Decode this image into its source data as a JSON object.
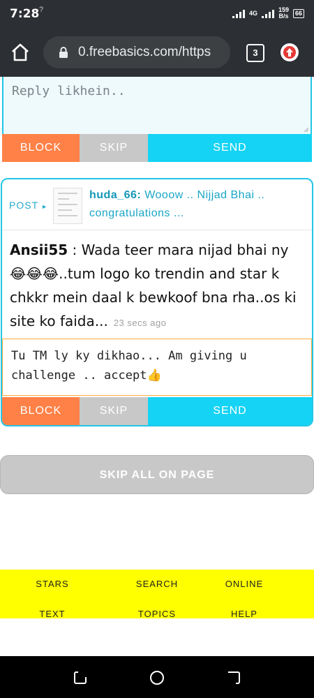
{
  "status": {
    "time": "7:28",
    "data_indicator": "?",
    "net_type": "4G",
    "speed_value": "159",
    "speed_unit": "B/s",
    "battery": "66"
  },
  "browser": {
    "url": "0.freebasics.com/https",
    "tab_count": "3"
  },
  "reply1": {
    "placeholder": "Reply likhein.."
  },
  "actions": {
    "block": "BLOCK",
    "skip": "SKIP",
    "send": "SEND"
  },
  "post": {
    "label": "POST",
    "author": "huda_66:",
    "preview": "Wooow .. Nijjad Bhai .. congratulations ...",
    "message_user": "Ansii55",
    "message_text": ": Wada teer mara nijad bhai ny 😂😂😂..tum logo ko trendin and star k chkkr mein daal k bewkoof bna rha..os ki site ko faida...",
    "timestamp": "23 secs ago",
    "reply_value": "Tu TM ly ky dikhao... Am giving u challenge .. accept👍"
  },
  "skip_all": "SKIP ALL ON PAGE",
  "footer": {
    "row1": [
      "STARS",
      "SEARCH",
      "ONLINE"
    ],
    "row2": [
      "TEXT",
      "TOPICS",
      "HELP"
    ]
  },
  "colors": {
    "accent": "#22c6e6",
    "block": "#ff8147",
    "send": "#14d3f4",
    "skip": "#c8c8c8",
    "footer": "#ffff00"
  }
}
